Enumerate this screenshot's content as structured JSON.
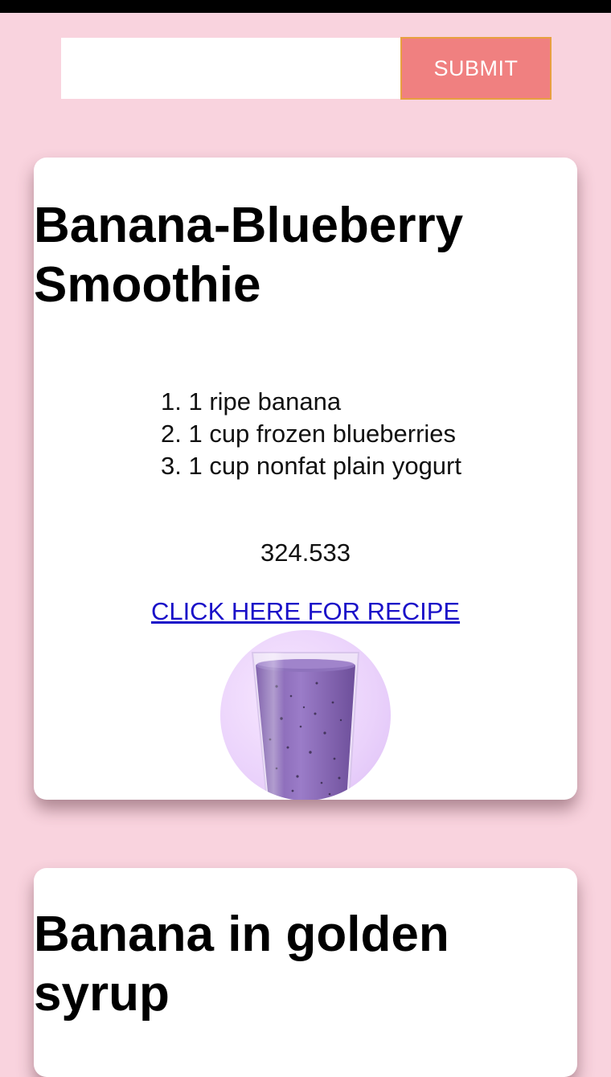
{
  "search": {
    "value": "",
    "placeholder": "",
    "submit_label": "SUBMIT"
  },
  "cards": [
    {
      "title": "Banana-Blueberry Smoothie",
      "ingredients": [
        "1. 1 ripe banana",
        "2. 1 cup frozen blueberries",
        "3. 1 cup nonfat plain yogurt"
      ],
      "calories": "324.533",
      "link_label": "CLICK HERE FOR RECIPE"
    },
    {
      "title": "Banana in golden syrup"
    }
  ],
  "colors": {
    "page_background": "#f9d3de",
    "submit_background": "#f08080",
    "submit_border": "#e8a040",
    "link": "#1a10c8"
  }
}
